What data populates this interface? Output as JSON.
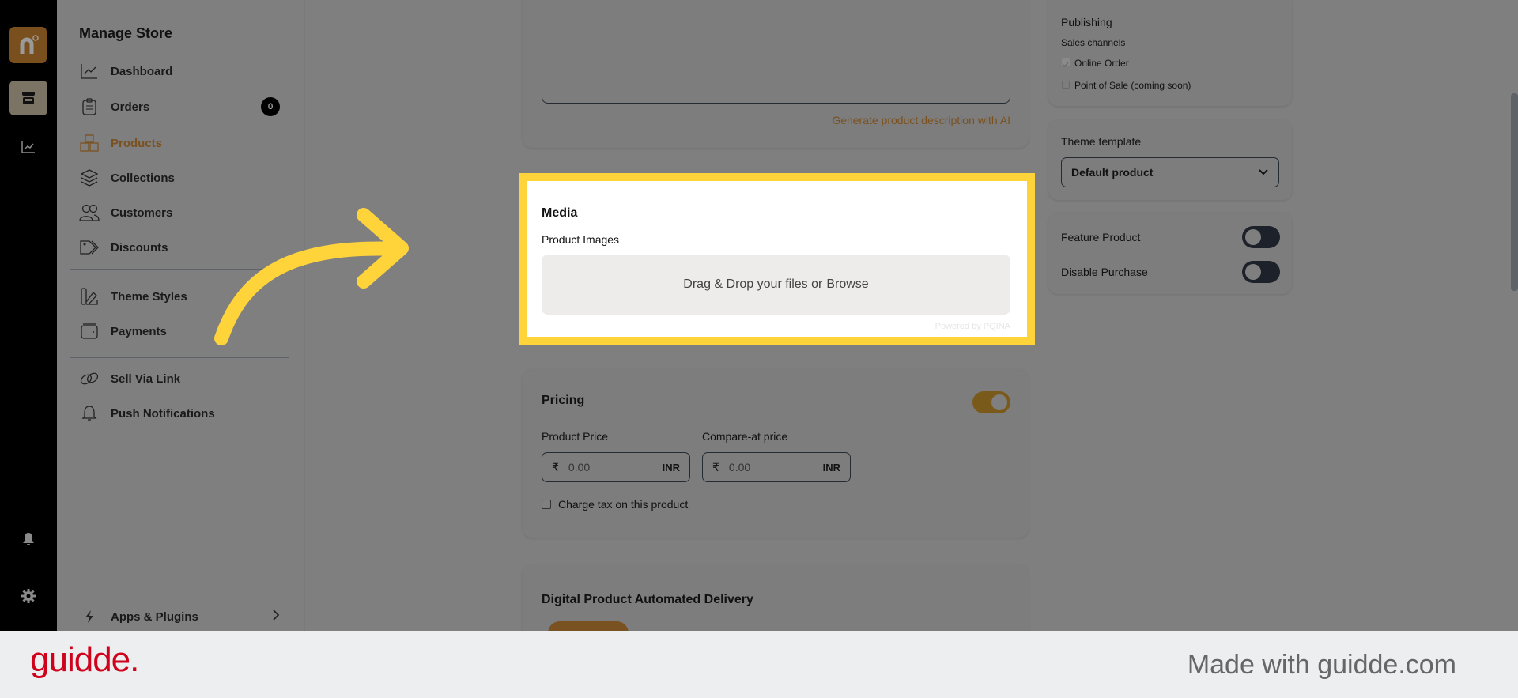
{
  "rail": {
    "icons": [
      "logo-n-icon",
      "store-icon",
      "analytics-icon",
      "bell-icon",
      "gear-icon"
    ]
  },
  "nav": {
    "title": "Manage Store",
    "items": [
      {
        "label": "Dashboard",
        "icon": "chart-line-icon"
      },
      {
        "label": "Orders",
        "icon": "clipboard-icon",
        "badge": "0"
      },
      {
        "label": "Products",
        "icon": "boxes-icon",
        "active": true
      },
      {
        "label": "Collections",
        "icon": "layers-icon"
      },
      {
        "label": "Customers",
        "icon": "users-icon"
      },
      {
        "label": "Discounts",
        "icon": "tag-icon"
      },
      {
        "label": "Theme Styles",
        "icon": "swatch-icon"
      },
      {
        "label": "Payments",
        "icon": "wallet-icon"
      },
      {
        "label": "Sell Via Link",
        "icon": "link-icon"
      },
      {
        "label": "Push Notifications",
        "icon": "bell-icon"
      },
      {
        "label": "Apps & Plugins",
        "icon": "bolt-icon"
      }
    ]
  },
  "description": {
    "ai_link": "Generate product description with AI"
  },
  "media": {
    "title": "Media",
    "subtitle": "Product Images",
    "dropzone_text": "Drag & Drop your files or",
    "browse_label": "Browse",
    "powered_by": "Powered by PQINA"
  },
  "pricing": {
    "title": "Pricing",
    "enabled": true,
    "product_price_label": "Product Price",
    "compare_price_label": "Compare-at price",
    "currency_symbol": "₹",
    "product_price_placeholder": "0.00",
    "compare_price_placeholder": "0.00",
    "currency_code": "INR",
    "tax_label": "Charge tax on this product",
    "tax_checked": false
  },
  "digital_delivery": {
    "title": "Digital Product Automated Delivery"
  },
  "publishing": {
    "title": "Publishing",
    "subtitle": "Sales channels",
    "channels": [
      {
        "label": "Online Order",
        "checked": true
      },
      {
        "label": "Point of Sale (coming soon)",
        "checked": false
      }
    ]
  },
  "theme_template": {
    "label": "Theme template",
    "selected": "Default product"
  },
  "flags": {
    "feature_product_label": "Feature Product",
    "feature_product_on": false,
    "disable_purchase_label": "Disable Purchase",
    "disable_purchase_on": false
  },
  "footer": {
    "logo": "guidde.",
    "made_with": "Made with guidde.com"
  },
  "colors": {
    "accent": "#7a5120",
    "highlight": "#ffd43b",
    "brand_red": "#d0021b"
  }
}
